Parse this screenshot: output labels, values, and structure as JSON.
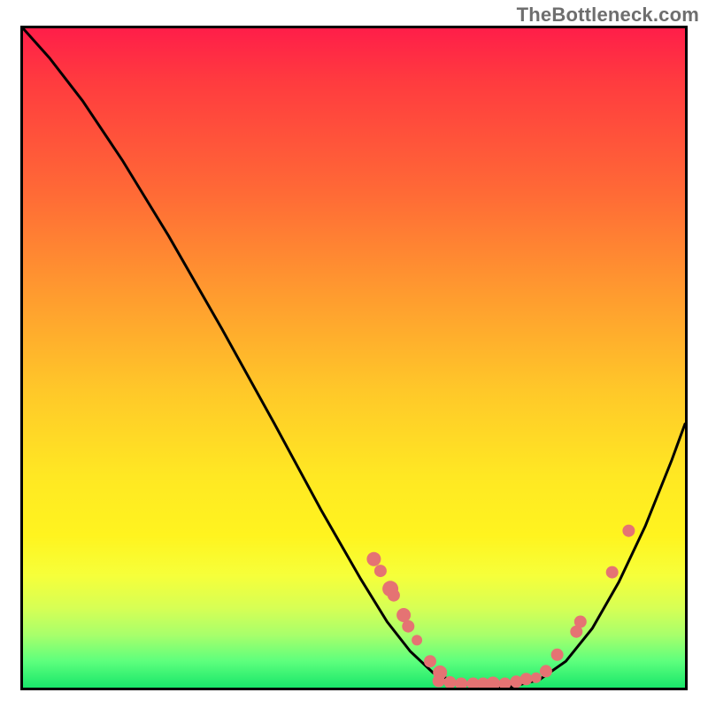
{
  "watermark": "TheBottleneck.com",
  "chart_data": {
    "type": "line",
    "title": "",
    "xlabel": "",
    "ylabel": "",
    "xlim": [
      0,
      1
    ],
    "ylim": [
      0,
      1
    ],
    "curve": {
      "name": "bottleneck-curve",
      "points": [
        {
          "x": 0.0,
          "y": 1.0
        },
        {
          "x": 0.04,
          "y": 0.955
        },
        {
          "x": 0.09,
          "y": 0.89
        },
        {
          "x": 0.15,
          "y": 0.8
        },
        {
          "x": 0.22,
          "y": 0.685
        },
        {
          "x": 0.3,
          "y": 0.545
        },
        {
          "x": 0.38,
          "y": 0.4
        },
        {
          "x": 0.45,
          "y": 0.27
        },
        {
          "x": 0.51,
          "y": 0.165
        },
        {
          "x": 0.55,
          "y": 0.1
        },
        {
          "x": 0.585,
          "y": 0.055
        },
        {
          "x": 0.62,
          "y": 0.022
        },
        {
          "x": 0.66,
          "y": 0.006
        },
        {
          "x": 0.7,
          "y": 0.002
        },
        {
          "x": 0.74,
          "y": 0.002
        },
        {
          "x": 0.78,
          "y": 0.012
        },
        {
          "x": 0.82,
          "y": 0.04
        },
        {
          "x": 0.86,
          "y": 0.09
        },
        {
          "x": 0.9,
          "y": 0.16
        },
        {
          "x": 0.94,
          "y": 0.245
        },
        {
          "x": 0.98,
          "y": 0.345
        },
        {
          "x": 1.0,
          "y": 0.4
        }
      ]
    },
    "dots": {
      "name": "sample-points",
      "color": "#e57373",
      "points": [
        {
          "x": 0.53,
          "y": 0.195,
          "r": 8
        },
        {
          "x": 0.54,
          "y": 0.177,
          "r": 7
        },
        {
          "x": 0.555,
          "y": 0.15,
          "r": 9
        },
        {
          "x": 0.56,
          "y": 0.14,
          "r": 7
        },
        {
          "x": 0.575,
          "y": 0.11,
          "r": 8
        },
        {
          "x": 0.582,
          "y": 0.093,
          "r": 7
        },
        {
          "x": 0.595,
          "y": 0.072,
          "r": 6
        },
        {
          "x": 0.615,
          "y": 0.04,
          "r": 7
        },
        {
          "x": 0.63,
          "y": 0.023,
          "r": 8
        },
        {
          "x": 0.628,
          "y": 0.01,
          "r": 7
        },
        {
          "x": 0.645,
          "y": 0.008,
          "r": 7
        },
        {
          "x": 0.662,
          "y": 0.006,
          "r": 7
        },
        {
          "x": 0.68,
          "y": 0.006,
          "r": 7
        },
        {
          "x": 0.695,
          "y": 0.006,
          "r": 7
        },
        {
          "x": 0.71,
          "y": 0.006,
          "r": 8
        },
        {
          "x": 0.728,
          "y": 0.006,
          "r": 7
        },
        {
          "x": 0.745,
          "y": 0.009,
          "r": 7
        },
        {
          "x": 0.76,
          "y": 0.013,
          "r": 7
        },
        {
          "x": 0.775,
          "y": 0.015,
          "r": 6
        },
        {
          "x": 0.79,
          "y": 0.025,
          "r": 7
        },
        {
          "x": 0.807,
          "y": 0.05,
          "r": 7
        },
        {
          "x": 0.836,
          "y": 0.085,
          "r": 7
        },
        {
          "x": 0.842,
          "y": 0.1,
          "r": 7
        },
        {
          "x": 0.89,
          "y": 0.175,
          "r": 7
        },
        {
          "x": 0.915,
          "y": 0.238,
          "r": 7
        }
      ]
    }
  }
}
